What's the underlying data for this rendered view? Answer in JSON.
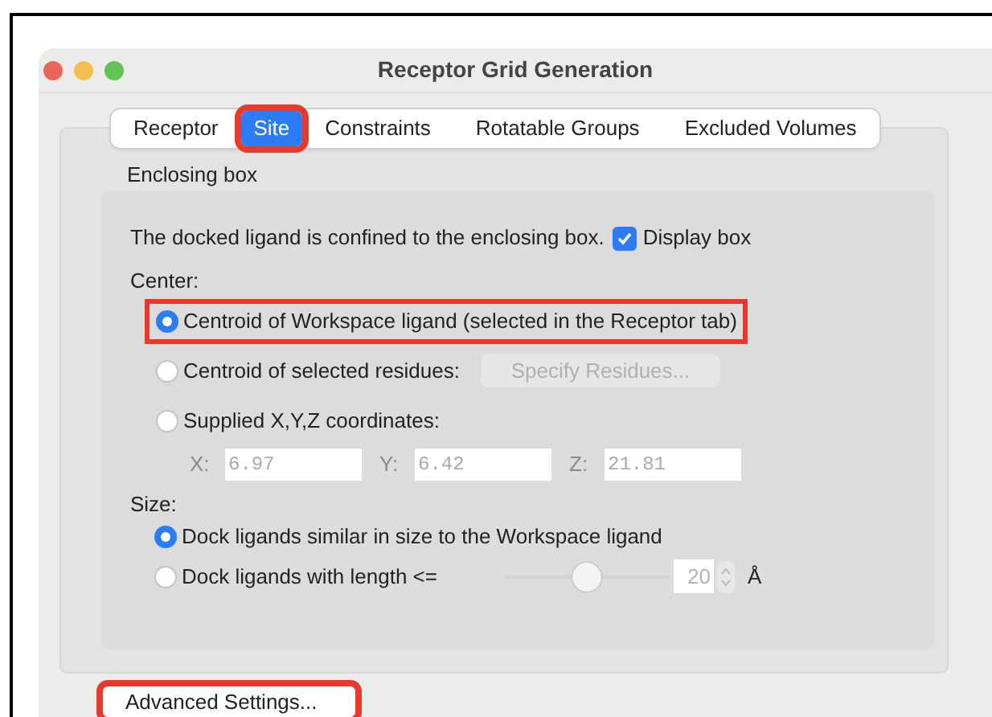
{
  "window": {
    "title": "Receptor Grid Generation"
  },
  "tabs": [
    {
      "label": "Receptor",
      "selected": false,
      "highlighted": false
    },
    {
      "label": "Site",
      "selected": true,
      "highlighted": true
    },
    {
      "label": "Constraints",
      "selected": false,
      "highlighted": false
    },
    {
      "label": "Rotatable Groups",
      "selected": false,
      "highlighted": false
    },
    {
      "label": "Excluded Volumes",
      "selected": false,
      "highlighted": false
    }
  ],
  "enclosing_box": {
    "title": "Enclosing box",
    "description": "The docked ligand is confined to the enclosing box.",
    "display_box": {
      "label": "Display box",
      "checked": true
    },
    "center": {
      "label": "Center:",
      "options": [
        {
          "label": "Centroid of Workspace ligand (selected in the Receptor tab)",
          "selected": true,
          "highlighted": true
        },
        {
          "label": "Centroid of selected residues:",
          "selected": false,
          "highlighted": false,
          "button": {
            "label": "Specify Residues...",
            "disabled": true
          }
        },
        {
          "label": "Supplied X,Y,Z coordinates:",
          "selected": false,
          "highlighted": false,
          "coordinates": [
            {
              "label": "X:",
              "value": "6.97"
            },
            {
              "label": "Y:",
              "value": "6.42"
            },
            {
              "label": "Z:",
              "value": "21.81"
            }
          ]
        }
      ]
    },
    "size": {
      "label": "Size:",
      "options": [
        {
          "label": "Dock ligands similar in size to the Workspace ligand",
          "selected": true,
          "highlighted": false
        },
        {
          "label": "Dock ligands with length <=",
          "selected": false,
          "highlighted": false,
          "slider": {
            "level": 0.5
          },
          "length": {
            "value": "20",
            "unit": "Å"
          }
        }
      ]
    }
  },
  "advanced_button": {
    "label": "Advanced Settings...",
    "highlighted": true
  }
}
